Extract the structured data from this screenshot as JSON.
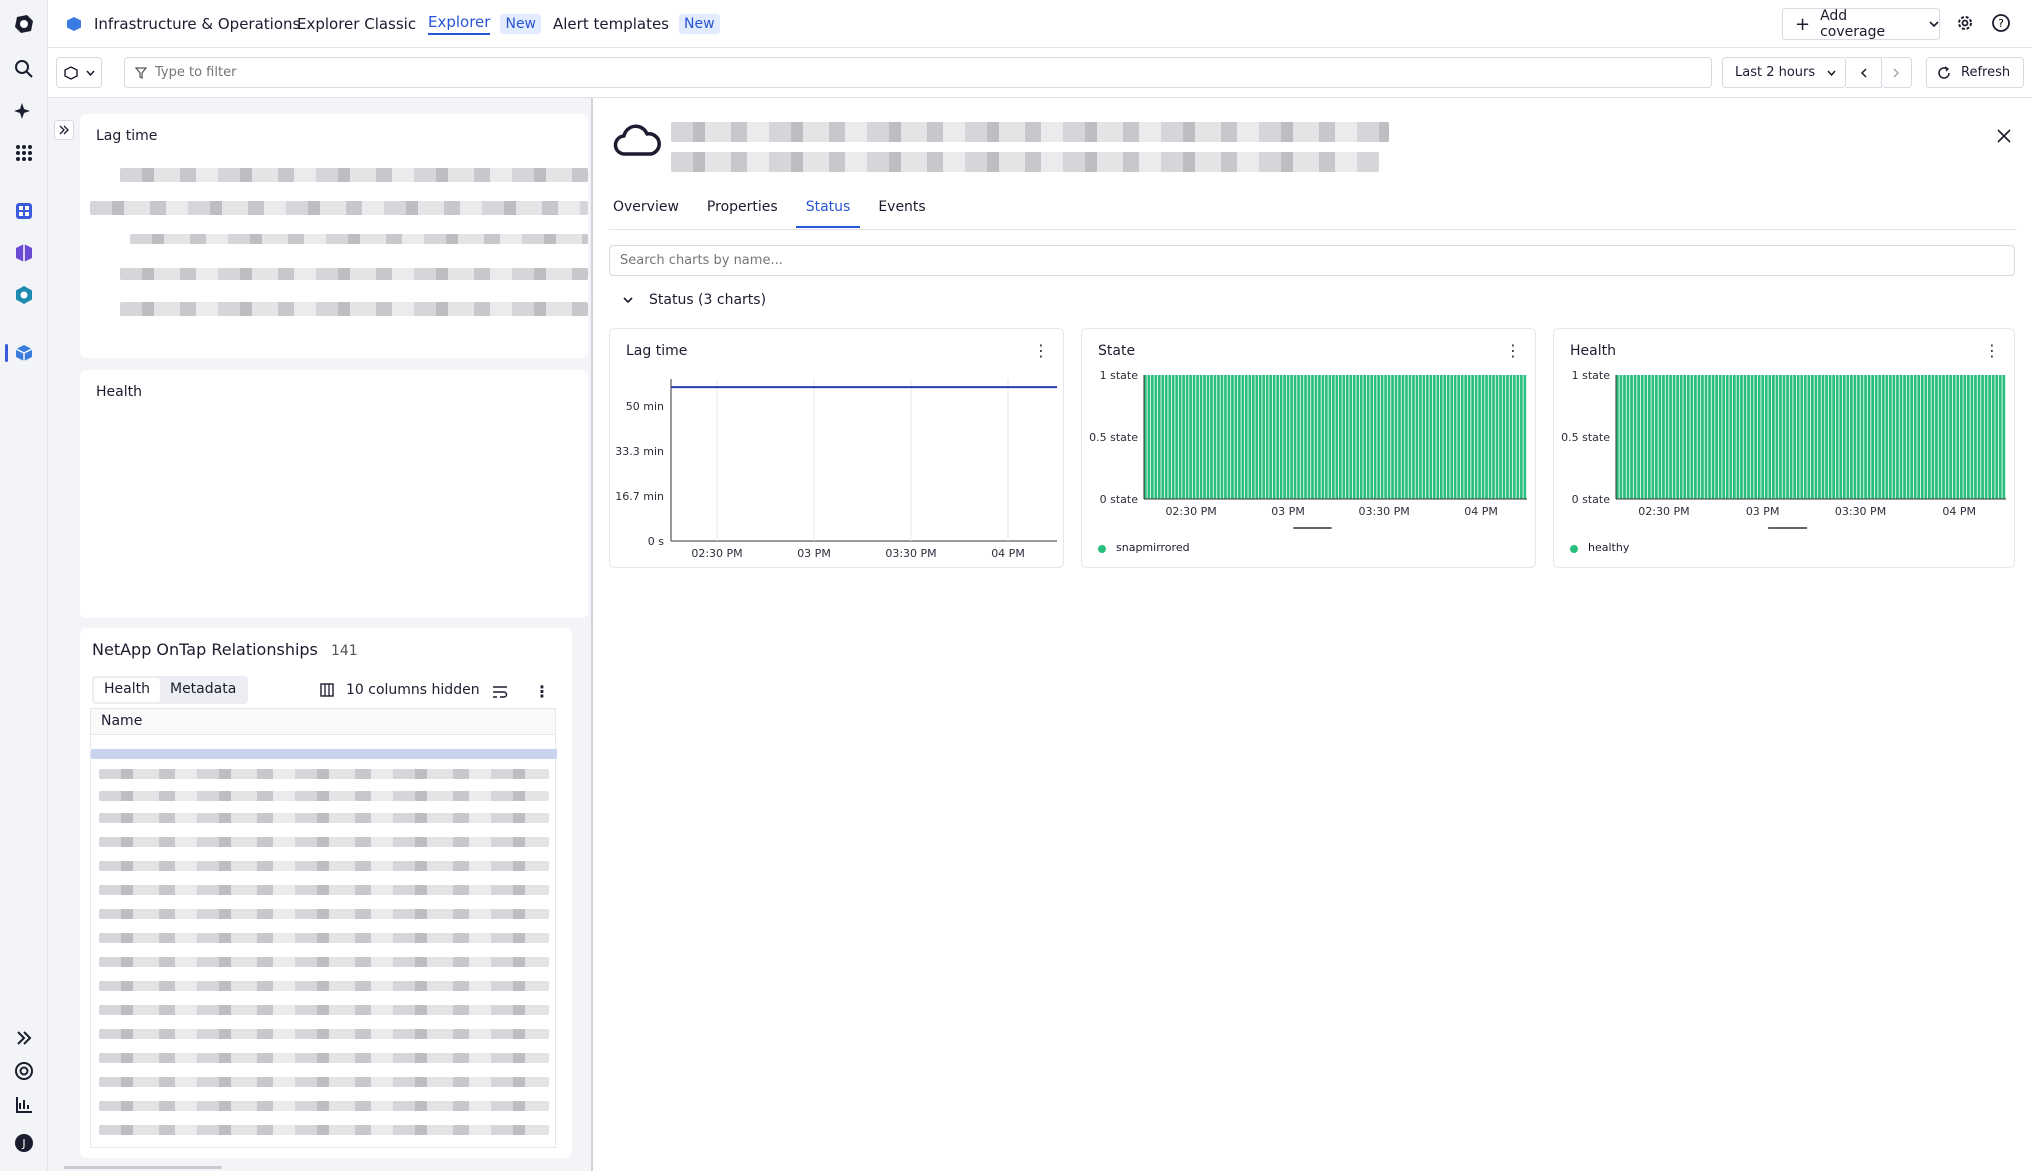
{
  "nav": {
    "app_title": "Infrastructure & Operations",
    "explorer_classic": "Explorer Classic",
    "explorer": "Explorer",
    "explorer_badge": "New",
    "alert_templates": "Alert templates",
    "alert_badge": "New",
    "add_coverage": "Add coverage"
  },
  "filter": {
    "placeholder": "Type to filter",
    "timeframe": "Last 2 hours",
    "refresh": "Refresh"
  },
  "left": {
    "lag_title": "Lag time",
    "health_title": "Health",
    "table_title": "NetApp OnTap Relationships",
    "table_count": "141",
    "tab_health": "Health",
    "tab_metadata": "Metadata",
    "columns_hidden": "10 columns hidden",
    "col_name": "Name"
  },
  "detail": {
    "tabs": [
      "Overview",
      "Properties",
      "Status",
      "Events"
    ],
    "active_tab": "Status",
    "search_placeholder": "Search charts by name...",
    "section": "Status (3 charts)"
  },
  "chart_data": [
    {
      "type": "line",
      "title": "Lag time",
      "x": [
        "02:30 PM",
        "03 PM",
        "03:30 PM",
        "04 PM"
      ],
      "y_ticks": [
        "50 min",
        "33.3 min",
        "16.7 min",
        "0 s"
      ],
      "series": [
        {
          "values": [
            57,
            57,
            57,
            57,
            57
          ]
        }
      ],
      "color": "#2a3fa8"
    },
    {
      "type": "bar",
      "title": "State",
      "x": [
        "02:30 PM",
        "03 PM",
        "03:30 PM",
        "04 PM"
      ],
      "y_ticks": [
        "1 state",
        "0.5 state",
        "0 state"
      ],
      "series": [
        {
          "name": "snapmirrored",
          "value": 1
        }
      ],
      "color": "#2bbf7e"
    },
    {
      "type": "bar",
      "title": "Health",
      "x": [
        "02:30 PM",
        "03 PM",
        "03:30 PM",
        "04 PM"
      ],
      "y_ticks": [
        "1 state",
        "0.5 state",
        "0 state"
      ],
      "series": [
        {
          "name": "healthy",
          "value": 1
        }
      ],
      "color": "#2bbf7e"
    }
  ]
}
